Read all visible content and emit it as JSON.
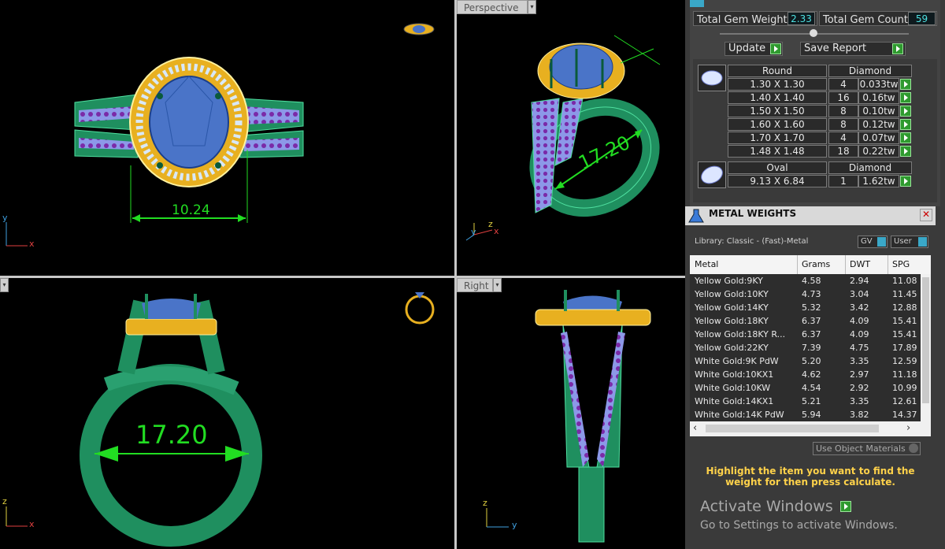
{
  "viewports": {
    "top": {
      "dimension": "10.24",
      "axis_x": "x",
      "axis_y": "y"
    },
    "perspective": {
      "label": "Perspective",
      "dimension": "17.20",
      "axis_x": "x",
      "axis_y": "y",
      "axis_z": "z"
    },
    "front": {
      "dimension": "17.20",
      "axis_x": "x",
      "axis_z": "z"
    },
    "right": {
      "label": "Right",
      "axis_y": "y",
      "axis_z": "z"
    }
  },
  "gem_panel": {
    "total_weight_label": "Total Gem Weight",
    "total_weight_value": "2.33",
    "total_count_label": "Total Gem Count",
    "total_count_value": "59",
    "update_label": "Update",
    "save_report_label": "Save Report",
    "round": {
      "shape": "Round",
      "type": "Diamond",
      "rows": [
        {
          "size": "1.30 X 1.30",
          "count": "4",
          "weight": "0.033tw"
        },
        {
          "size": "1.40 X 1.40",
          "count": "16",
          "weight": "0.16tw"
        },
        {
          "size": "1.50 X 1.50",
          "count": "8",
          "weight": "0.10tw"
        },
        {
          "size": "1.60 X 1.60",
          "count": "8",
          "weight": "0.12tw"
        },
        {
          "size": "1.70 X 1.70",
          "count": "4",
          "weight": "0.07tw"
        },
        {
          "size": "1.48 X 1.48",
          "count": "18",
          "weight": "0.22tw"
        }
      ]
    },
    "oval": {
      "shape": "Oval",
      "type": "Diamond",
      "rows": [
        {
          "size": "9.13 X 6.84",
          "count": "1",
          "weight": "1.62tw"
        }
      ]
    }
  },
  "metal_panel": {
    "title": "METAL WEIGHTS",
    "close": "✕",
    "library": "Library: Classic - (Fast)-Metal",
    "gv_label": "GV",
    "user_label": "User",
    "columns": [
      "Metal",
      "Grams",
      "DWT",
      "SPG"
    ],
    "rows": [
      {
        "metal": "Yellow Gold:9KY",
        "grams": "4.58",
        "dwt": "2.94",
        "spg": "11.08"
      },
      {
        "metal": "Yellow Gold:10KY",
        "grams": "4.73",
        "dwt": "3.04",
        "spg": "11.45"
      },
      {
        "metal": "Yellow Gold:14KY",
        "grams": "5.32",
        "dwt": "3.42",
        "spg": "12.88"
      },
      {
        "metal": "Yellow Gold:18KY",
        "grams": "6.37",
        "dwt": "4.09",
        "spg": "15.41"
      },
      {
        "metal": "Yellow Gold:18KY R...",
        "grams": "6.37",
        "dwt": "4.09",
        "spg": "15.41"
      },
      {
        "metal": "Yellow Gold:22KY",
        "grams": "7.39",
        "dwt": "4.75",
        "spg": "17.89"
      },
      {
        "metal": "White Gold:9K PdW",
        "grams": "5.20",
        "dwt": "3.35",
        "spg": "12.59"
      },
      {
        "metal": "White Gold:10KX1",
        "grams": "4.62",
        "dwt": "2.97",
        "spg": "11.18"
      },
      {
        "metal": "White Gold:10KW",
        "grams": "4.54",
        "dwt": "2.92",
        "spg": "10.99"
      },
      {
        "metal": "White Gold:14KX1",
        "grams": "5.21",
        "dwt": "3.35",
        "spg": "12.61"
      },
      {
        "metal": "White Gold:14K PdW",
        "grams": "5.94",
        "dwt": "3.82",
        "spg": "14.37"
      }
    ],
    "use_object_materials": "Use Object Materials",
    "hint": "Highlight the item you want to find the weight for then press calculate."
  },
  "watermark": {
    "line1": "Activate Windows",
    "line2": "Go to Settings to activate Windows."
  },
  "colors": {
    "metal_green": "#1f8f5f",
    "halo_gold": "#e8b020",
    "center_stone": "#4a74c8",
    "accent_stones": "#7a2aa8",
    "dimension_green": "#22dd22",
    "hint_yellow": "#ffd24a"
  }
}
